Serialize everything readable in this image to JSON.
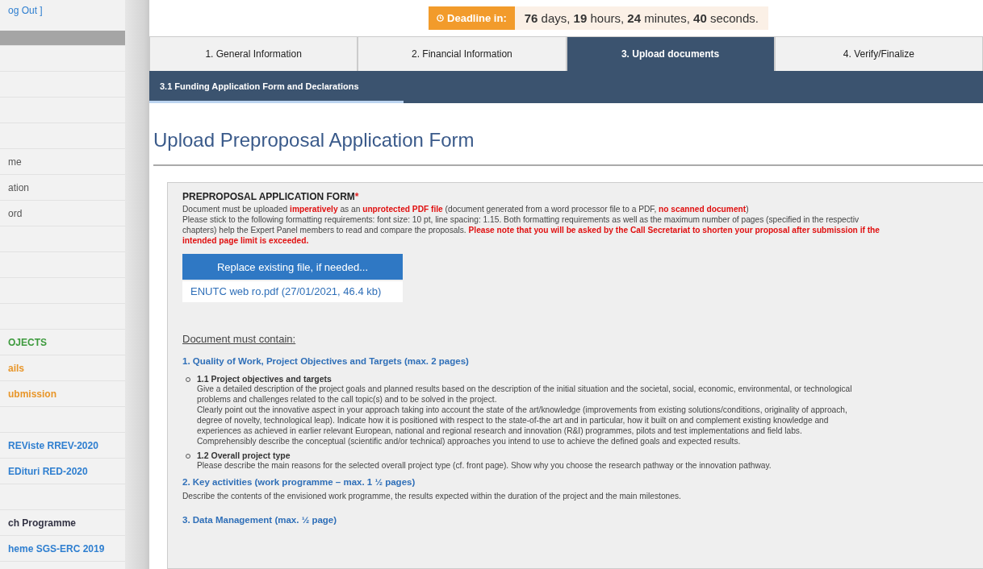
{
  "sidebar": {
    "logout": "og Out ]",
    "items": [
      {
        "kind": "header"
      },
      {
        "kind": "plain"
      },
      {
        "kind": "plain"
      },
      {
        "kind": "plain"
      },
      {
        "kind": "plain"
      },
      {
        "label": "me",
        "kind": "plain"
      },
      {
        "label": "ation",
        "kind": "plain"
      },
      {
        "label": "ord",
        "kind": "plain"
      },
      {
        "kind": "plain"
      },
      {
        "kind": "plain"
      },
      {
        "kind": "plain"
      },
      {
        "kind": "plain"
      },
      {
        "label": "OJECTS",
        "kind": "plain",
        "color": "#3d9a3d"
      },
      {
        "label": "ails",
        "kind": "plain",
        "color": "#e8962a"
      },
      {
        "label": "ubmission",
        "kind": "plain",
        "color": "#e8962a"
      },
      {
        "kind": "plain"
      },
      {
        "label": "REViste RREV-2020",
        "kind": "plain",
        "color": "#2f7fd0"
      },
      {
        "label": "EDituri RED-2020",
        "kind": "plain",
        "color": "#2f7fd0"
      },
      {
        "kind": "plain"
      },
      {
        "label": "ch Programme",
        "kind": "plain",
        "color": "#333344"
      },
      {
        "label": "heme SGS-ERC 2019",
        "kind": "plain",
        "color": "#2f7fd0"
      }
    ]
  },
  "deadline": {
    "label": "Deadline in:",
    "value": "**76** days, **19** hours, **24** minutes, **40** seconds."
  },
  "tabs": [
    {
      "label": "1. General Information",
      "selected": false
    },
    {
      "label": "2. Financial Information",
      "selected": false
    },
    {
      "label": "3. Upload documents",
      "selected": true
    },
    {
      "label": "4. Verify/Finalize",
      "selected": false
    }
  ],
  "subtabs": [
    {
      "label": "3.1 Funding Application Form and Declarations",
      "selected": true
    }
  ],
  "title": "Upload Preproposal Application Form",
  "form": {
    "heading": "PREPROPOSAL APPLICATION FORM",
    "required_mark": "*",
    "lines": [
      [
        {
          "text": "Document must be uploaded ",
          "emphasis": false
        },
        {
          "text": "imperatively",
          "emphasis": true
        },
        {
          "text": " as an ",
          "emphasis": false
        },
        {
          "text": "unprotected PDF file",
          "emphasis": true
        },
        {
          "text": " (document generated from a word processor file to a PDF, ",
          "emphasis": false
        },
        {
          "text": "no scanned document",
          "emphasis": true
        },
        {
          "text": ")",
          "emphasis": false
        }
      ],
      [
        {
          "text": "Please stick to the following formatting requirements: font size: 10 pt, line spacing: 1.15. Both formatting requirements as well as the maximum number of pages (specified in the respectiv",
          "emphasis": false
        }
      ],
      [
        {
          "text": "chapters) help the Expert Panel members to read and compare the proposals. ",
          "emphasis": false
        },
        {
          "text": "Please note that you will be asked by the Call Secretariat to shorten your proposal after submission if the",
          "emphasis": true
        }
      ],
      [
        {
          "text": "intended page limit is exceeded.",
          "emphasis": true
        }
      ]
    ],
    "button": "Replace existing file, if needed...",
    "file_link": "ENUTC web ro.pdf (27/01/2021, 46.4 kb)"
  },
  "contents": {
    "heading": "Document must contain:",
    "sections": [
      {
        "title": "1. Quality of Work, Project Objectives and Targets (max. 2 pages)",
        "items": [
          {
            "title": "1.1 Project objectives and targets",
            "lines": [
              "Give a detailed description of the project goals and planned results based on the description of the initial situation and the societal, social, economic, environmental, or technological",
              "problems and challenges related to the call topic(s) and to be solved in the project.",
              "Clearly point out the innovative aspect in your approach taking into account the state of the art/knowledge (improvements from existing solutions/conditions, originality of approach,",
              "degree of novelty, technological leap). Indicate how it is positioned with respect to the state-of-the art and in particular, how it built on and complement existing knowledge and",
              "experiences as achieved in earlier relevant European, national and regional research and innovation (R&I) programmes, pilots and test implementations and field labs.",
              "Comprehensibly describe the conceptual (scientific and/or technical) approaches you intend to use to achieve the defined goals and expected results."
            ]
          },
          {
            "title": "1.2 Overall project type",
            "lines": [
              "Please describe the main reasons for the selected overall project type (cf. front page). Show why you choose the research pathway or the innovation pathway."
            ]
          }
        ]
      },
      {
        "title": "2. Key activities (work programme – max. 1 ½ pages)",
        "text": "Describe the contents of the envisioned work programme, the results expected within the duration of the project and the main milestones."
      },
      {
        "title": "3. Data Management (max. ½ page)"
      }
    ]
  }
}
